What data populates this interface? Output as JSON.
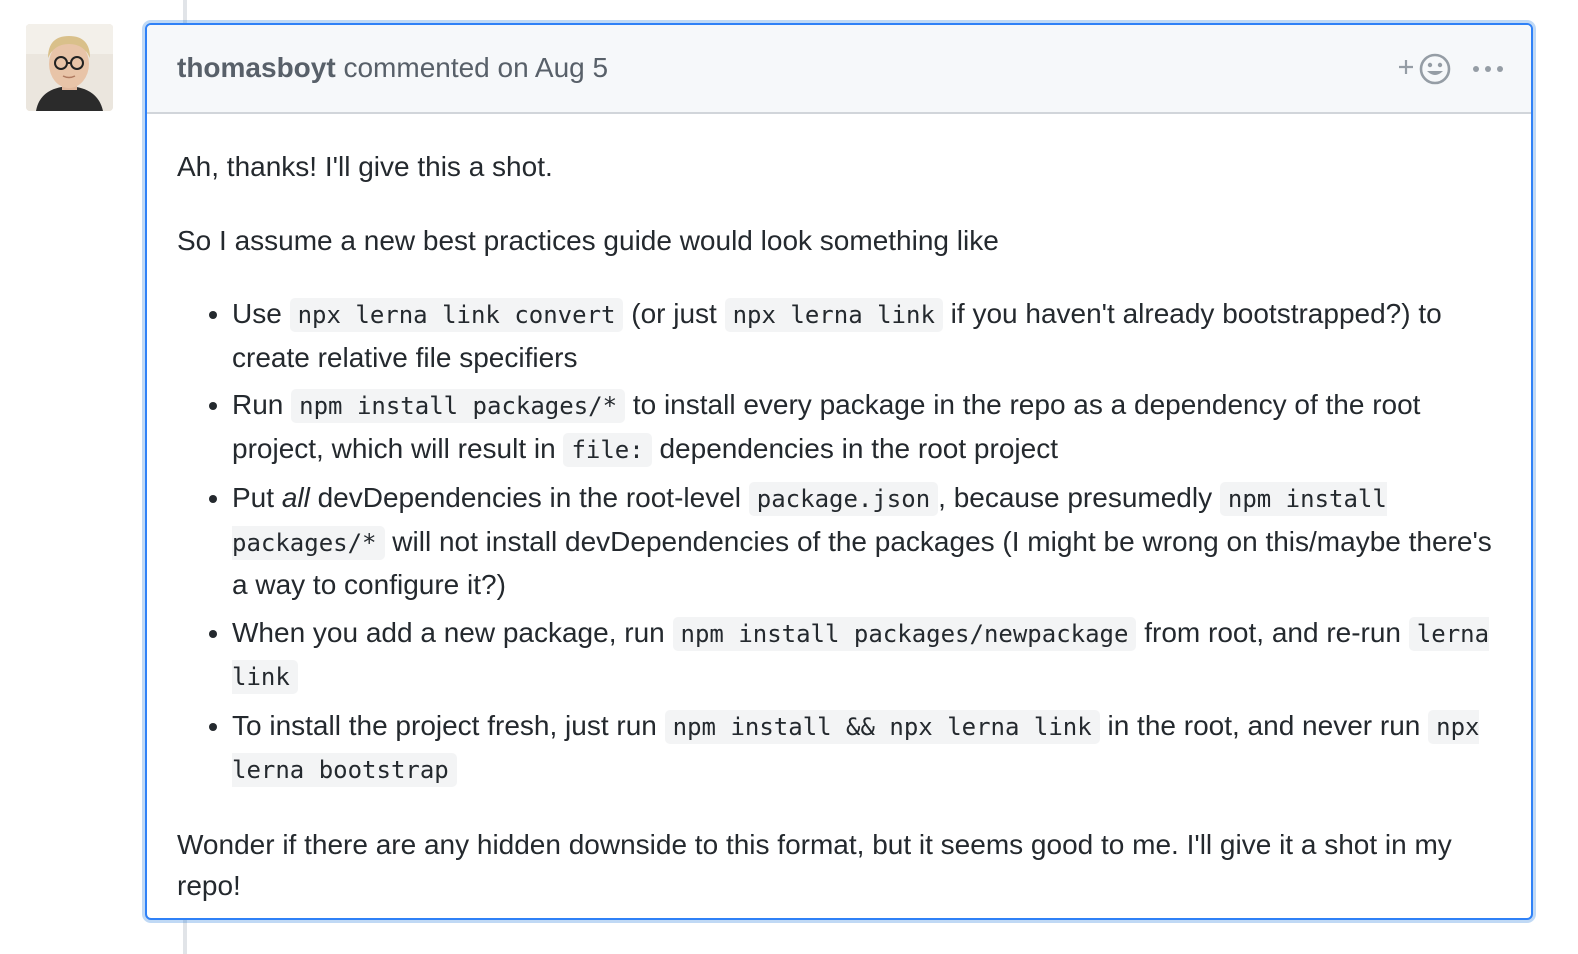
{
  "comment": {
    "author": "thomasboyt",
    "meta": "commented on Aug 5",
    "reaction_icon": "smiley-plus-icon",
    "more_icon": "kebab-horizontal-icon",
    "intro": "Ah, thanks! I'll give this a shot.",
    "lead": "So I assume a new best practices guide would look something like",
    "bullets": [
      {
        "t1": "Use ",
        "c1": "npx lerna link convert",
        "t2": " (or just ",
        "c2": "npx lerna link",
        "t3": " if you haven't already bootstrapped?) to create relative file specifiers"
      },
      {
        "t1": "Run ",
        "c1": "npm install packages/*",
        "t2": " to install every package in the repo as a dependency of the root project, which will result in ",
        "c2": "file:",
        "t3": " dependencies in the root project"
      },
      {
        "t1": "Put ",
        "em": "all",
        "t2": " devDependencies in the root-level ",
        "c1": "package.json",
        "t3": ", because presumedly ",
        "c2": "npm install packages/*",
        "t4": " will not install devDependencies of the packages (I might be wrong on this/maybe there's a way to configure it?)"
      },
      {
        "t1": "When you add a new package, run ",
        "c1": "npm install packages/newpackage",
        "t2": " from root, and re-run ",
        "c2": "lerna link"
      },
      {
        "t1": "To install the project fresh, just run ",
        "c1": "npm install && npx lerna link",
        "t2": " in the root, and never run ",
        "c2": "npx lerna bootstrap"
      }
    ],
    "outro": "Wonder if there are any hidden downside to this format, but it seems good to me. I'll give it a shot in my repo!"
  },
  "colors": {
    "focus_border": "#2f81f7",
    "header_bg": "#f6f8fa",
    "text": "#24292e",
    "muted": "#586069"
  }
}
